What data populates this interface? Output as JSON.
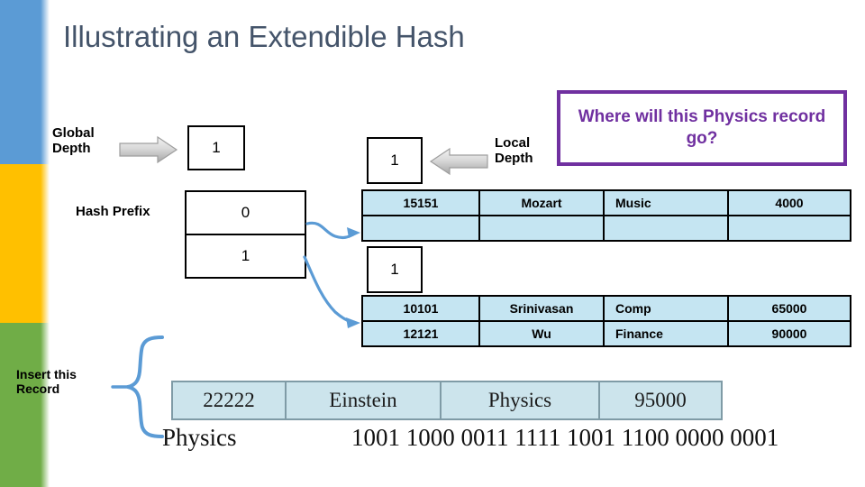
{
  "slide": {
    "title": "Illustrating an Extendible Hash"
  },
  "labels": {
    "global_depth": "Global Depth",
    "hash_prefix": "Hash Prefix",
    "local_depth": "Local Depth",
    "insert_record": "Insert this Record"
  },
  "global_depth_value": "1",
  "directory": {
    "entries": [
      "0",
      "1"
    ]
  },
  "buckets": [
    {
      "local_depth": "1",
      "rows": [
        {
          "id": "15151",
          "name": "Mozart",
          "dept": "Music",
          "salary": "4000"
        },
        {
          "id": "",
          "name": "",
          "dept": "",
          "salary": ""
        }
      ]
    },
    {
      "local_depth": "1",
      "rows": [
        {
          "id": "10101",
          "name": "Srinivasan",
          "dept": "Comp",
          "salary": "65000"
        },
        {
          "id": "12121",
          "name": "Wu",
          "dept": "Finance",
          "salary": "90000"
        }
      ]
    }
  ],
  "callout": {
    "text": "Where will this Physics record go?",
    "border_color": "#7030A0",
    "text_color": "#7030A0"
  },
  "insert_record": {
    "id": "22222",
    "name": "Einstein",
    "dept": "Physics",
    "salary": "95000"
  },
  "hash_line": {
    "key": "Physics",
    "bits": "1001 1000 0011 1111 1001 1100 0000 0001"
  },
  "colors": {
    "sidebar_blue": "#5B9BD5",
    "sidebar_yellow": "#FFC000",
    "sidebar_green": "#70AD47",
    "title": "#44546A",
    "bucket_fill": "#C5E5F2",
    "arrow_blue": "#5B9BD5",
    "arrow_gray": "#BFBFBF",
    "record_fill": "#CCE4EC"
  }
}
